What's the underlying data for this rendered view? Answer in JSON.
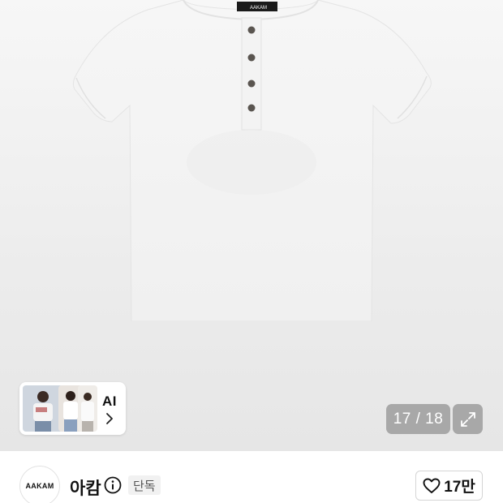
{
  "gallery": {
    "product_image_alt": "",
    "shirt_tag_text": "AAKAM",
    "ai_card": {
      "label": "AI",
      "arrow_icon": "chevron-right-icon"
    },
    "counter": {
      "text": "17 / 18",
      "current": 17,
      "total": 18
    },
    "expand_icon": "expand-arrows-icon"
  },
  "store": {
    "logo_text": "AAKAM",
    "name": "아캄",
    "info_icon": "info-circle-icon",
    "badge": "단독",
    "like": {
      "icon": "heart-outline-icon",
      "count": "17만"
    }
  },
  "colors": {
    "gallery_bg": "#ececec",
    "counter_bg": "#969696",
    "badge_bg": "#f1f1f1"
  }
}
